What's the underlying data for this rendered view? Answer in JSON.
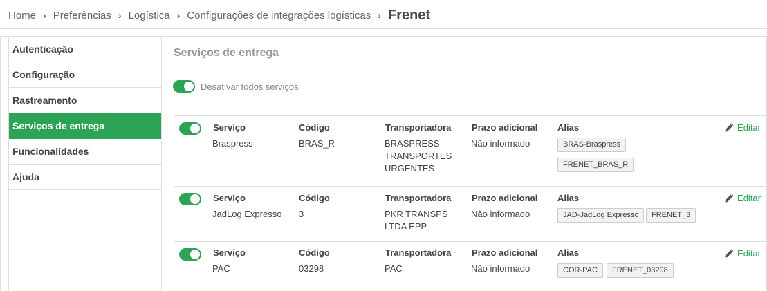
{
  "breadcrumb": {
    "items": [
      "Home",
      "Preferências",
      "Logística",
      "Configurações de integrações logísticas"
    ],
    "current": "Frenet"
  },
  "sidebar": {
    "items": [
      {
        "label": "Autenticação"
      },
      {
        "label": "Configuração"
      },
      {
        "label": "Rastreamento"
      },
      {
        "label": "Serviços de entrega",
        "active": true
      },
      {
        "label": "Funcionalidades"
      },
      {
        "label": "Ajuda"
      }
    ]
  },
  "main": {
    "title": "Serviços de entrega",
    "toggle_all_label": "Desativar todos serviços",
    "toggle_all_on": true
  },
  "columns": {
    "service": "Serviço",
    "code": "Código",
    "carrier": "Transportadora",
    "extra_days": "Prazo adicional",
    "alias": "Alias"
  },
  "edit_label": "Editar",
  "services": [
    {
      "enabled": true,
      "name": "Braspress",
      "code": "BRAS_R",
      "carrier": [
        "BRASPRESS",
        "TRANSPORTES",
        "URGENTES"
      ],
      "extra_days": "Não informado",
      "aliases": [
        "BRAS-Braspress",
        "FRENET_BRAS_R"
      ]
    },
    {
      "enabled": true,
      "name": "JadLog Expresso",
      "code": "3",
      "carrier": [
        "PKR TRANSPS",
        "LTDA EPP"
      ],
      "extra_days": "Não informado",
      "aliases": [
        "JAD-JadLog Expresso",
        "FRENET_3"
      ]
    },
    {
      "enabled": true,
      "name": "PAC",
      "code": "03298",
      "carrier": [
        "PAC"
      ],
      "extra_days": "Não informado",
      "aliases": [
        "COR-PAC",
        "FRENET_03298"
      ]
    }
  ],
  "colors": {
    "accent": "#2da356",
    "border": "#dddddd",
    "muted_text": "#999999"
  }
}
